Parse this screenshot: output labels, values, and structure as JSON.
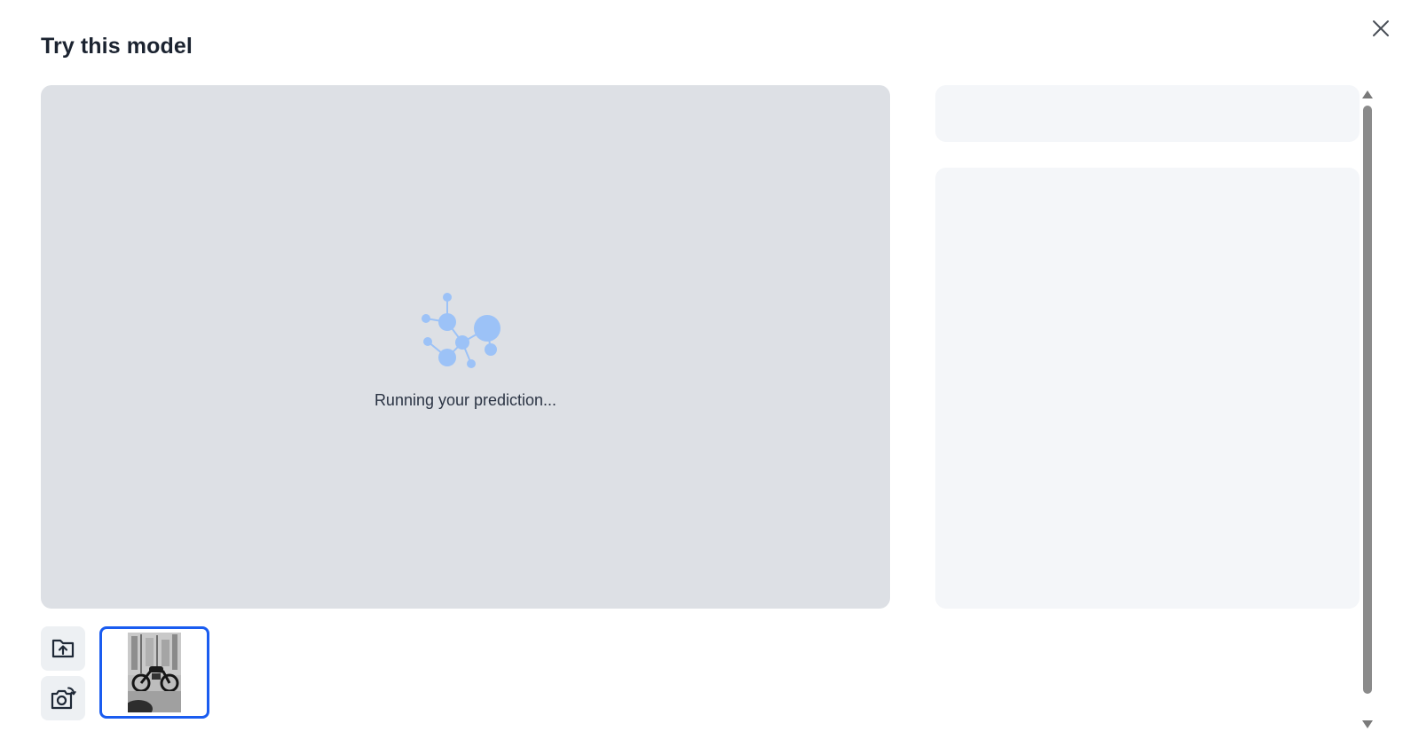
{
  "dialog": {
    "title": "Try this model"
  },
  "prediction": {
    "status_text": "Running your prediction..."
  },
  "icons": {
    "close": "close-icon",
    "loader": "network-molecule-icon",
    "upload": "folder-upload-icon",
    "camera": "camera-switch-icon"
  },
  "inputs": {
    "selected_image_alt": "motorcycle parked on street"
  },
  "colors": {
    "canvas_bg": "#dde0e5",
    "panel_bg": "#f4f6f9",
    "accent_border": "#1a5cf0",
    "loader_blue": "#9cc2f7"
  }
}
